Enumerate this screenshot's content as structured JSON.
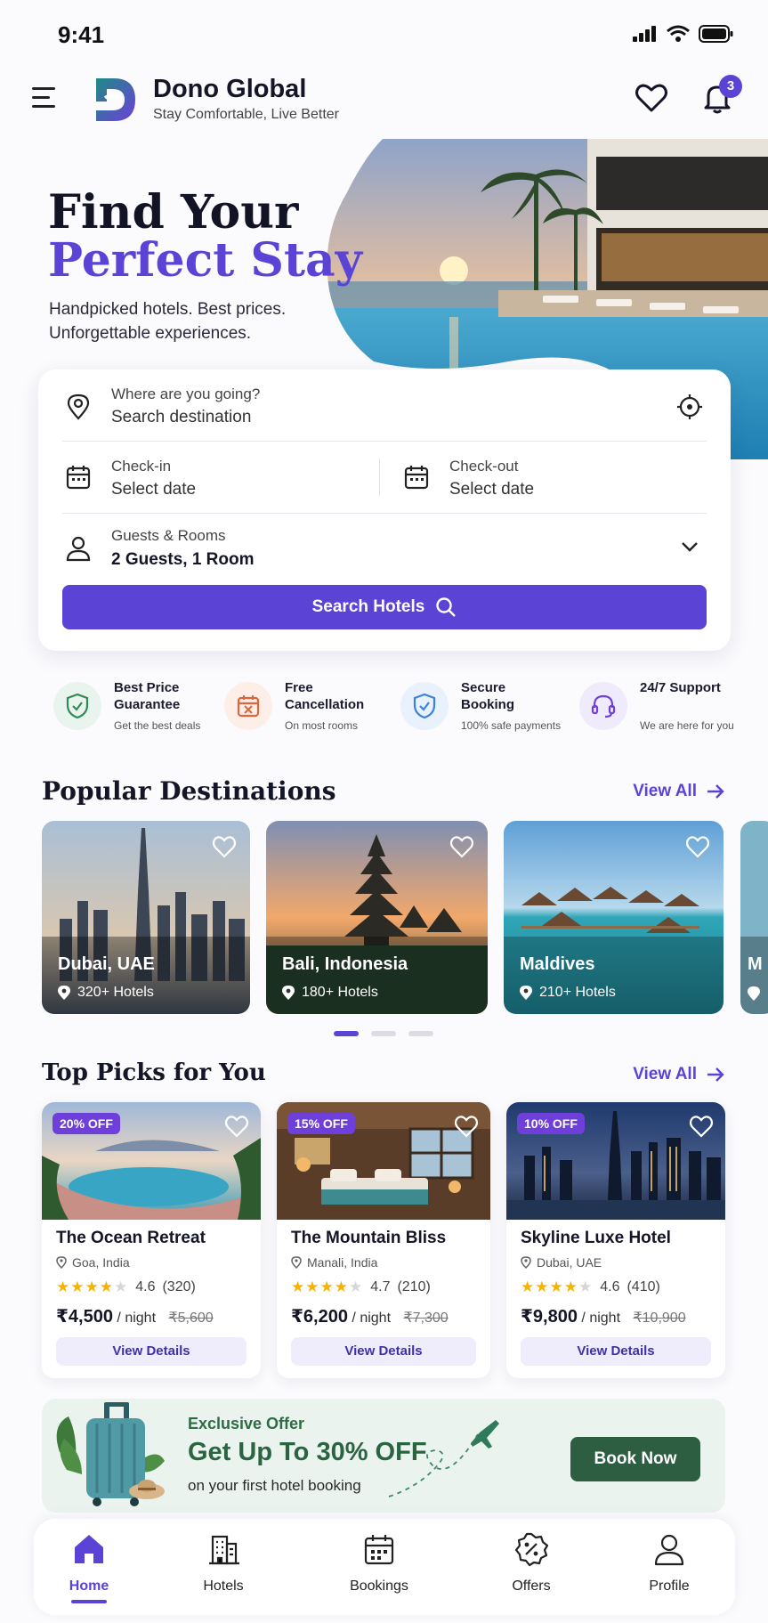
{
  "status_bar": {
    "time": "9:41"
  },
  "header": {
    "brand_name": "Dono Global",
    "tagline": "Stay Comfortable, Live Better",
    "notification_count": "3"
  },
  "hero": {
    "title_line1": "Find Your",
    "title_line2": "Perfect Stay",
    "subtitle": "Handpicked hotels. Best prices. Unforgettable experiences."
  },
  "search": {
    "destination_label": "Where are you going?",
    "destination_placeholder": "Search destination",
    "checkin_label": "Check-in",
    "checkin_value": "Select date",
    "checkout_label": "Check-out",
    "checkout_value": "Select date",
    "guests_label": "Guests & Rooms",
    "guests_value": "2 Guests, 1 Room",
    "button_label": "Search Hotels"
  },
  "features": [
    {
      "title": "Best Price Guarantee",
      "desc": "Get the best deals",
      "color": "#2f8a55",
      "bg": "#e9f4ee"
    },
    {
      "title": "Free Cancellation",
      "desc": "On most rooms",
      "color": "#e0653a",
      "bg": "#fdeee7"
    },
    {
      "title": "Secure Booking",
      "desc": "100% safe payments",
      "color": "#3b82e0",
      "bg": "#e8f1fc"
    },
    {
      "title": "24/7 Support",
      "desc": "We are here for you",
      "color": "#6e3fd9",
      "bg": "#f0ebfc"
    }
  ],
  "destinations": {
    "title": "Popular Destinations",
    "view_all": "View All",
    "items": [
      {
        "name": "Dubai, UAE",
        "count": "320+ Hotels"
      },
      {
        "name": "Bali, Indonesia",
        "count": "180+ Hotels"
      },
      {
        "name": "Maldives",
        "count": "210+ Hotels"
      },
      {
        "name": "M",
        "count": ""
      }
    ]
  },
  "top_picks": {
    "title": "Top Picks for You",
    "view_all": "View All",
    "hotels": [
      {
        "badge": "20% OFF",
        "name": "The Ocean Retreat",
        "location": "Goa, India",
        "rating": "4.6",
        "reviews": "(320)",
        "price": "₹4,500",
        "per": "/ night",
        "old_price": "₹5,600",
        "button": "View Details"
      },
      {
        "badge": "15% OFF",
        "name": "The Mountain Bliss",
        "location": "Manali, India",
        "rating": "4.7",
        "reviews": "(210)",
        "price": "₹6,200",
        "per": "/ night",
        "old_price": "₹7,300",
        "button": "View Details"
      },
      {
        "badge": "10% OFF",
        "name": "Skyline Luxe Hotel",
        "location": "Dubai, UAE",
        "rating": "4.6",
        "reviews": "(410)",
        "price": "₹9,800",
        "per": "/ night",
        "old_price": "₹10,900",
        "button": "View Details"
      }
    ]
  },
  "offer": {
    "eyebrow": "Exclusive Offer",
    "title": "Get Up To 30% OFF",
    "subtitle": "on your first hotel booking",
    "button": "Book Now"
  },
  "bottom_nav": [
    {
      "label": "Home",
      "icon": "home-icon",
      "active": true
    },
    {
      "label": "Hotels",
      "icon": "building-icon",
      "active": false
    },
    {
      "label": "Bookings",
      "icon": "calendar-icon",
      "active": false
    },
    {
      "label": "Offers",
      "icon": "discount-icon",
      "active": false
    },
    {
      "label": "Profile",
      "icon": "user-icon",
      "active": false
    }
  ],
  "colors": {
    "accent": "#5b43d6",
    "offer_green": "#2d5e42"
  }
}
